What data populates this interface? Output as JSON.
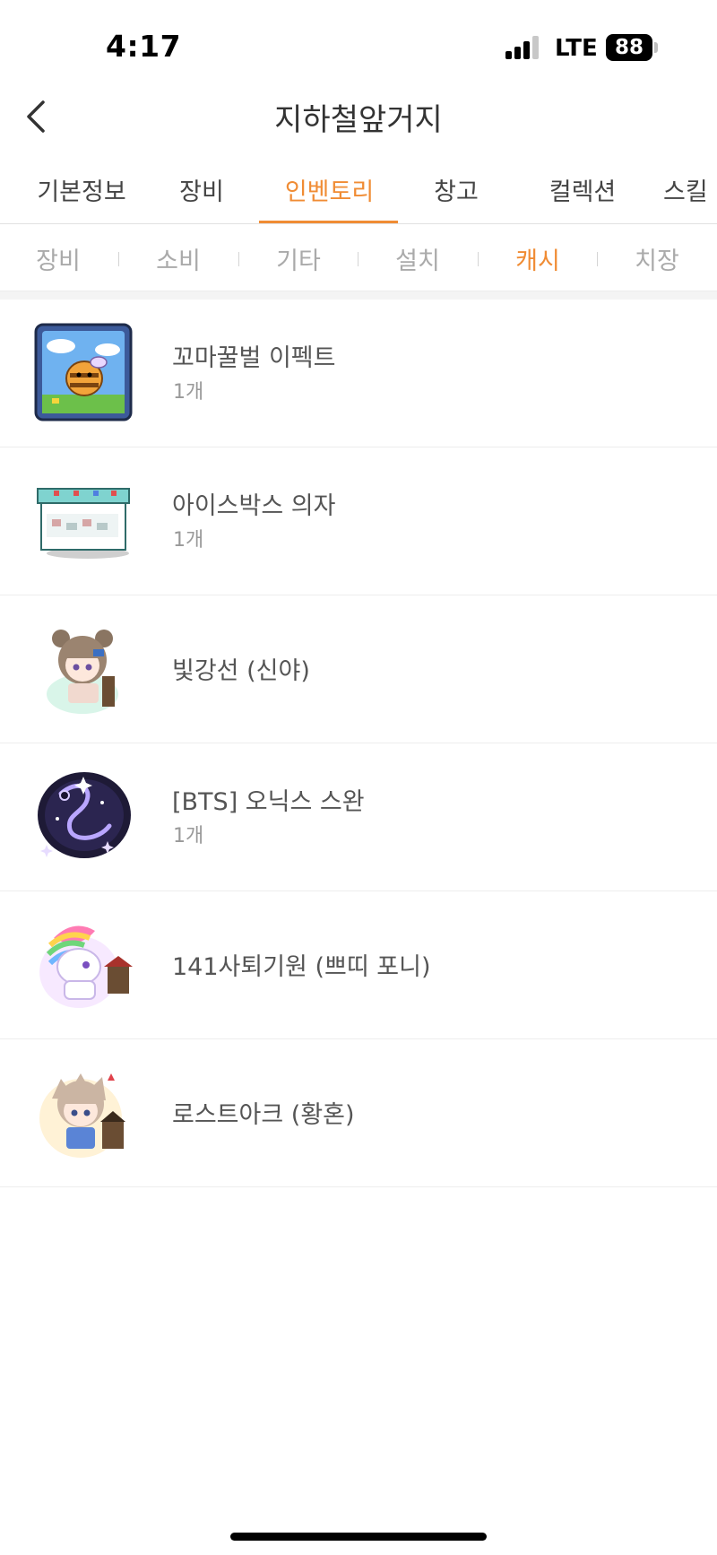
{
  "status_bar": {
    "time": "4:17",
    "network": "LTE",
    "battery": "88"
  },
  "header": {
    "title": "지하철앞거지",
    "back_icon": "chevron-left-icon"
  },
  "main_tabs": [
    {
      "label": "기본정보",
      "active": false
    },
    {
      "label": "장비",
      "active": false
    },
    {
      "label": "인벤토리",
      "active": true
    },
    {
      "label": "창고",
      "active": false
    },
    {
      "label": "컬렉션",
      "active": false
    },
    {
      "label": "스킬",
      "active": false
    }
  ],
  "sub_tabs": [
    {
      "label": "장비",
      "active": false
    },
    {
      "label": "소비",
      "active": false
    },
    {
      "label": "기타",
      "active": false
    },
    {
      "label": "설치",
      "active": false
    },
    {
      "label": "캐시",
      "active": true
    },
    {
      "label": "치장",
      "active": false
    }
  ],
  "items": [
    {
      "name": "꼬마꿀벌 이펙트",
      "count": "1개",
      "icon": "bee-effect-icon"
    },
    {
      "name": "아이스박스 의자",
      "count": "1개",
      "icon": "icebox-chair-icon"
    },
    {
      "name": "빛강선 (신야)",
      "count": "",
      "icon": "character-shinya-icon"
    },
    {
      "name": "[BTS] 오닉스 스완",
      "count": "1개",
      "icon": "onyx-swan-icon"
    },
    {
      "name": "141사퇴기원 (쁘띠 포니)",
      "count": "",
      "icon": "petit-pony-icon"
    },
    {
      "name": "로스트아크 (황혼)",
      "count": "",
      "icon": "character-twilight-icon"
    }
  ],
  "colors": {
    "accent": "#f08c34",
    "text": "#555555",
    "muted": "#aaaaaa"
  }
}
